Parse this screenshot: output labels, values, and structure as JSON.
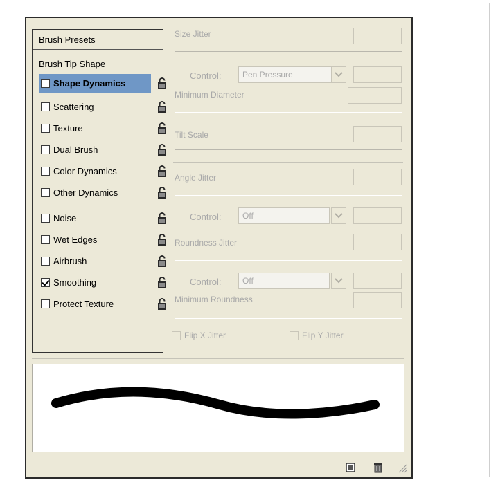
{
  "list": {
    "presets": "Brush Presets",
    "tip_shape": "Brush Tip Shape",
    "items": [
      {
        "label": "Shape Dynamics",
        "checked": false,
        "selected": true
      },
      {
        "label": "Scattering",
        "checked": false
      },
      {
        "label": "Texture",
        "checked": false
      },
      {
        "label": "Dual Brush",
        "checked": false
      },
      {
        "label": "Color Dynamics",
        "checked": false
      },
      {
        "label": "Other Dynamics",
        "checked": false
      },
      {
        "label": "Noise",
        "checked": false
      },
      {
        "label": "Wet Edges",
        "checked": false
      },
      {
        "label": "Airbrush",
        "checked": false
      },
      {
        "label": "Smoothing",
        "checked": true
      },
      {
        "label": "Protect Texture",
        "checked": false
      }
    ]
  },
  "controls": {
    "size_jitter": "Size Jitter",
    "control_label": "Control:",
    "size_control_value": "Pen Pressure",
    "minimum_diameter": "Minimum Diameter",
    "tilt_scale": "Tilt Scale",
    "angle_jitter": "Angle Jitter",
    "angle_control_value": "Off",
    "roundness_jitter": "Roundness Jitter",
    "roundness_control_value": "Off",
    "minimum_roundness": "Minimum Roundness",
    "flip_x": "Flip X Jitter",
    "flip_y": "Flip Y Jitter"
  },
  "icons": {
    "lock": "lock-icon",
    "new_preset": "new-preset-icon",
    "delete": "trash-icon",
    "resize": "resize-grip-icon",
    "dropdown": "chevron-down-icon"
  },
  "colors": {
    "panel_bg": "#ece9d8",
    "selection": "#6f97c6",
    "disabled_text": "#a9a9a9"
  }
}
